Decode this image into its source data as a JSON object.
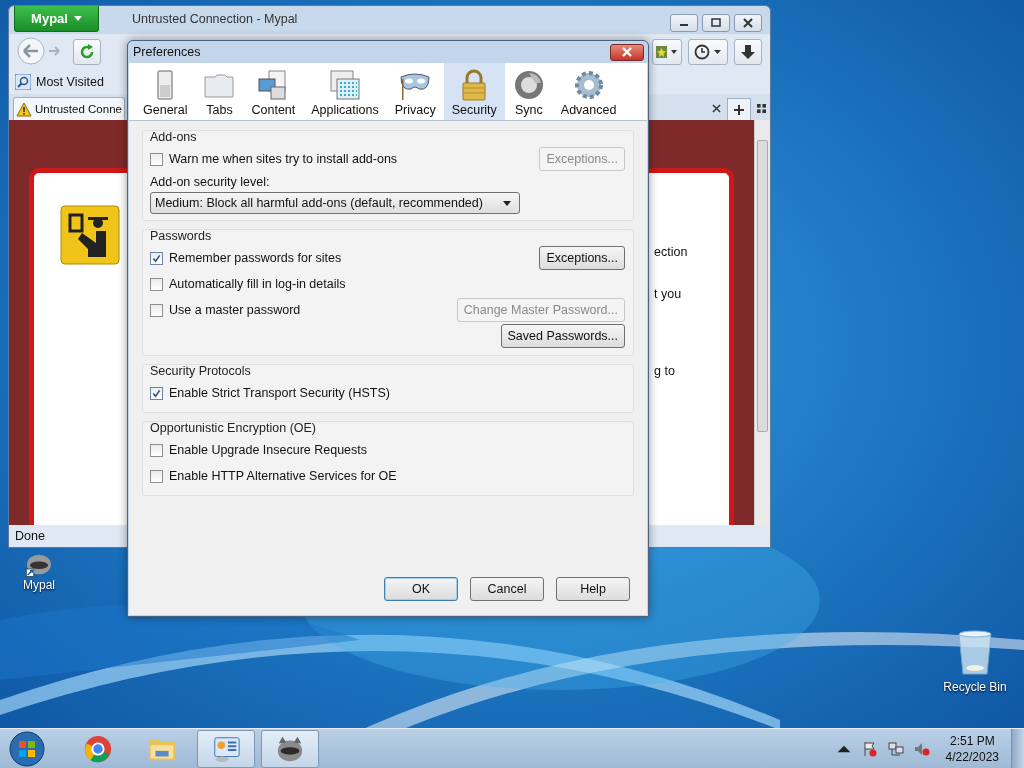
{
  "desktop": {
    "icons": [
      {
        "label": "Mypal"
      },
      {
        "label": "Recycle Bin"
      }
    ]
  },
  "browser": {
    "menu_button": "Mypal",
    "title": "Untrusted Connection - Mypal",
    "bookmark": "Most Visited",
    "tab": "Untrusted Conne",
    "page_fragments": [
      "ection",
      "t you",
      "g to"
    ],
    "status": "Done"
  },
  "dialog": {
    "title": "Preferences",
    "panes": [
      {
        "label": "General",
        "selected": false
      },
      {
        "label": "Tabs",
        "selected": false
      },
      {
        "label": "Content",
        "selected": false
      },
      {
        "label": "Applications",
        "selected": false
      },
      {
        "label": "Privacy",
        "selected": false
      },
      {
        "label": "Security",
        "selected": true
      },
      {
        "label": "Sync",
        "selected": false
      },
      {
        "label": "Advanced",
        "selected": false
      }
    ],
    "groups": [
      {
        "title": "Add-ons",
        "rows": [
          {
            "kind": "checkbox",
            "label": "Warn me when sites try to install add-ons",
            "checked": false,
            "button": {
              "label": "Exceptions...",
              "disabled": true
            }
          },
          {
            "kind": "label",
            "label": "Add-on security level:"
          },
          {
            "kind": "dropdown",
            "value": "Medium: Block all harmful add-ons (default, recommended)"
          }
        ]
      },
      {
        "title": "Passwords",
        "rows": [
          {
            "kind": "checkbox",
            "label": "Remember passwords for sites",
            "checked": true,
            "button": {
              "label": "Exceptions...",
              "disabled": false
            }
          },
          {
            "kind": "checkbox",
            "label": "Automatically fill in log-in details",
            "checked": false
          },
          {
            "kind": "checkbox",
            "label": "Use a master password",
            "checked": false,
            "button": {
              "label": "Change Master Password...",
              "disabled": true
            }
          },
          {
            "kind": "button",
            "button": {
              "label": "Saved Passwords...",
              "disabled": false
            }
          }
        ]
      },
      {
        "title": "Security Protocols",
        "rows": [
          {
            "kind": "checkbox",
            "label": "Enable Strict Transport Security (HSTS)",
            "checked": true
          }
        ]
      },
      {
        "title": "Opportunistic Encryption (OE)",
        "rows": [
          {
            "kind": "checkbox",
            "label": "Enable Upgrade Insecure Requests",
            "checked": false
          },
          {
            "kind": "checkbox",
            "label": "Enable HTTP Alternative Services for OE",
            "checked": false
          }
        ]
      }
    ],
    "buttons": [
      {
        "label": "OK",
        "default": true
      },
      {
        "label": "Cancel",
        "default": false
      },
      {
        "label": "Help",
        "default": false
      }
    ]
  },
  "taskbar": {
    "apps": [
      {
        "running": false
      },
      {
        "running": false
      },
      {
        "running": true
      },
      {
        "running": true
      }
    ],
    "time": "2:51 PM",
    "date": "4/22/2023"
  }
}
